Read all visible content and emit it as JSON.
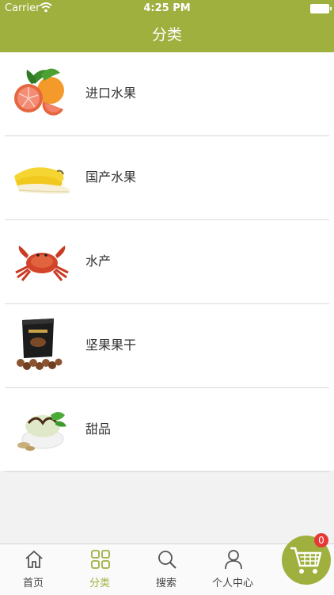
{
  "status_bar": {
    "carrier": "Carrier",
    "time": "4:25 PM"
  },
  "nav": {
    "title": "分类"
  },
  "categories": [
    {
      "label": "进口水果",
      "icon": "grapefruit-image"
    },
    {
      "label": "国产水果",
      "icon": "banana-image"
    },
    {
      "label": "水产",
      "icon": "crab-image"
    },
    {
      "label": "坚果果干",
      "icon": "nuts-image"
    },
    {
      "label": "甜品",
      "icon": "dessert-image"
    }
  ],
  "tabs": [
    {
      "label": "首页",
      "icon": "home-icon",
      "active": false
    },
    {
      "label": "分类",
      "icon": "grid-icon",
      "active": true
    },
    {
      "label": "搜索",
      "icon": "search-icon",
      "active": false
    },
    {
      "label": "个人中心",
      "icon": "person-icon",
      "active": false
    }
  ],
  "cart": {
    "count": "0"
  },
  "colors": {
    "brand": "#9fb03f",
    "badge": "#e53935"
  }
}
